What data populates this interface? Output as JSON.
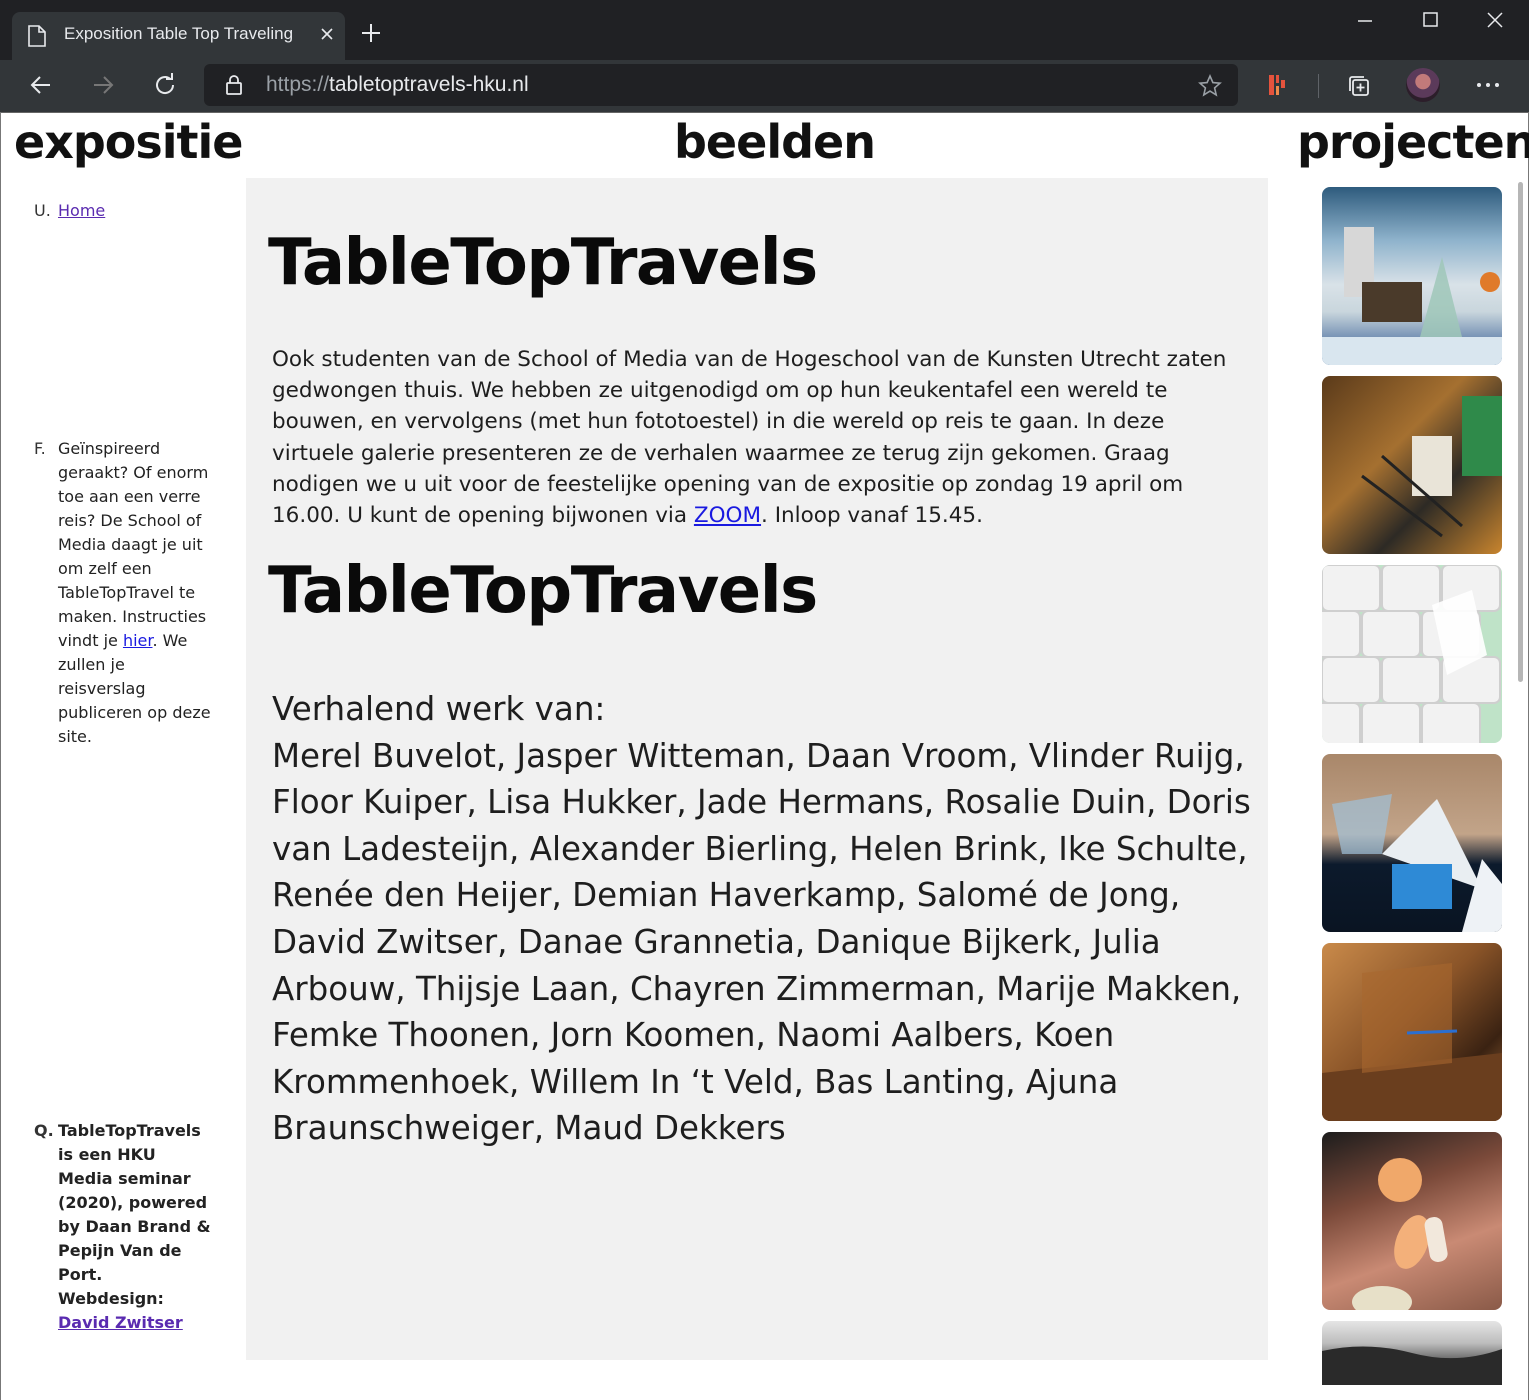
{
  "browser": {
    "tab_title": "Exposition Table Top Traveling",
    "url_prefix": "https://",
    "url_domain": "tabletoptravels-hku.nl"
  },
  "header": {
    "left": "expositie",
    "center": "beelden",
    "right": "projecten"
  },
  "sidebar": {
    "home": {
      "glyph": "U.",
      "link": "Home"
    },
    "challenge": {
      "glyph": "F.",
      "text_before": "Geïnspireerd geraakt? Of enorm toe aan een verre reis? De School of Media daagt je uit om zelf een TableTopTravel te maken. Instructies vindt je ",
      "link": "hier",
      "text_after": ". We zullen je reisverslag publiceren op deze site."
    },
    "credits": {
      "glyph": "Q.",
      "text": "TableTopTravels is een HKU Media seminar (2020), powered by Daan Brand & Pepijn Van de Port. Webdesign: ",
      "link": "David Zwitser"
    }
  },
  "main": {
    "title": "TableTopTravels",
    "intro_before": "Ook studenten van de School of Media van de Hogeschool van de Kunsten Utrecht zaten gedwongen thuis. We hebben ze uitgenodigd om op hun keukentafel een wereld te bouwen, en vervolgens (met hun fototoestel) in die wereld op reis te gaan. In deze virtuele galerie presenteren ze de verhalen waarmee ze terug zijn gekomen. Graag nodigen we u uit voor de feestelijke opening van de expositie op zondag 19 april om 16.00. U kunt de opening bijwonen via ",
    "intro_link": "ZOOM",
    "intro_after": ". Inloop vanaf 15.45.",
    "title_2": "TableTopTravels",
    "authors_heading": "Verhalend werk van:",
    "authors": "Merel Buvelot, Jasper Witteman, Daan Vroom, Vlinder Ruijg, Floor Kuiper, Lisa Hukker, Jade Hermans, Rosalie Duin, Doris van Ladesteijn, Alexander Bierling, Helen Brink, Ike Schulte, Renée den Heijer, Demian Haverkamp, Salomé de Jong, David Zwitser, Danae Grannetia, Danique Bijkerk, Julia Arbouw, Thijsje Laan, Chayren Zimmerman, Marije Makken, Femke Thoonen, Jorn Koomen, Naomi Aalbers, Koen Krommenhoek, Willem In ‘t Veld, Bas Lanting, Ajuna Braunschweiger, Maud Dekkers"
  },
  "projects": [
    {
      "name": "project-photo-glass-landscape"
    },
    {
      "name": "project-photo-plush-bear"
    },
    {
      "name": "project-photo-toilet-paper-wall"
    },
    {
      "name": "project-photo-glass-tent"
    },
    {
      "name": "project-photo-cardboard-room"
    },
    {
      "name": "project-photo-doll-parts"
    },
    {
      "name": "project-photo-black-white"
    }
  ]
}
